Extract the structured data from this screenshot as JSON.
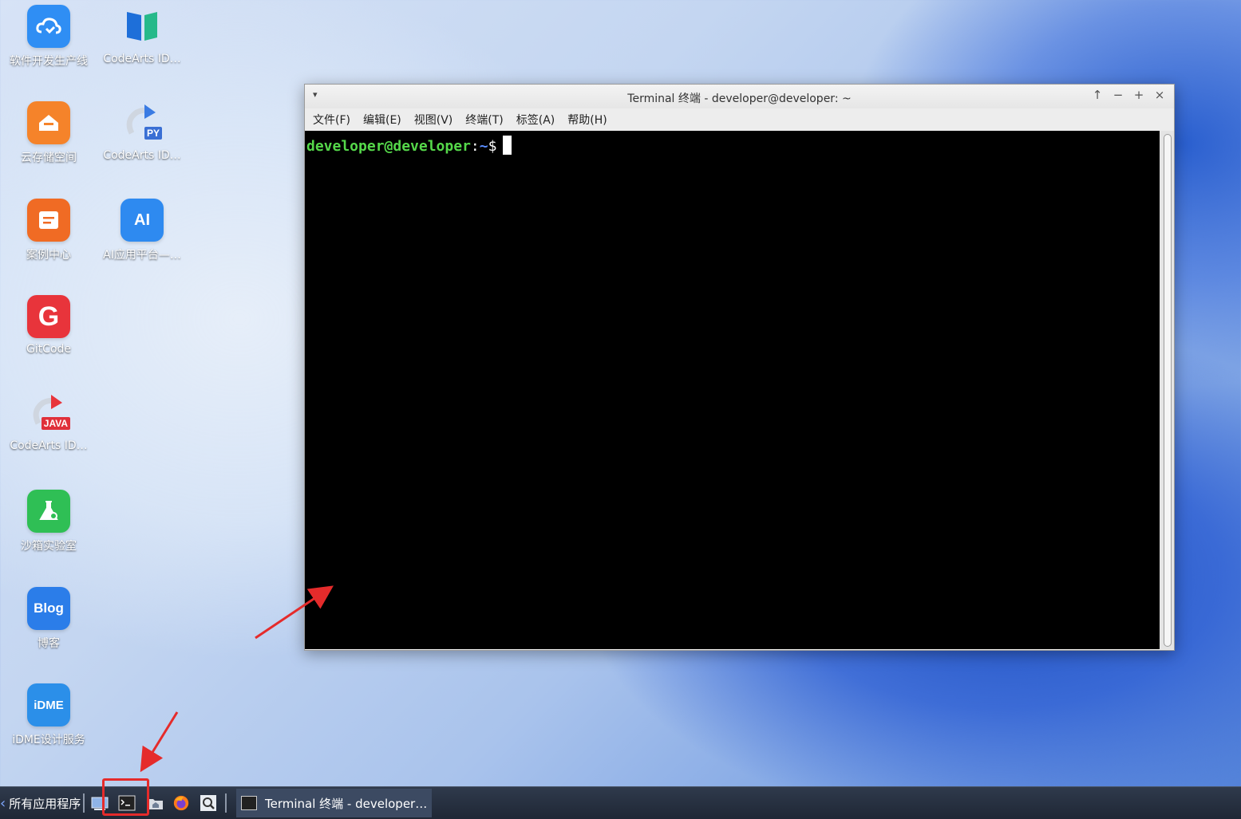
{
  "desktop": {
    "icons": [
      {
        "label": "软件开发生产线",
        "icon": "cloud-devops-icon",
        "color": "#2f8ef4"
      },
      {
        "label": "CodeArts ID…",
        "icon": "codearts-ide-icon",
        "color": "#1e6fd9"
      },
      {
        "label": "云存储空间",
        "icon": "cloud-storage-icon",
        "color": "#f5832a"
      },
      {
        "label": "CodeArts ID…",
        "icon": "codearts-python-icon",
        "color": "#3a7be3",
        "badge": "PY"
      },
      {
        "label": "案例中心",
        "icon": "case-center-icon",
        "color": "#f06b24"
      },
      {
        "label": "AI应用平台—…",
        "icon": "ai-platform-icon",
        "color": "#2e8af0",
        "badge": "AI"
      },
      {
        "label": "GitCode",
        "icon": "gitcode-icon",
        "color": "#e8343b",
        "badge": "G"
      },
      {
        "label": "CodeArts ID…",
        "icon": "codearts-java-icon",
        "color": "#d93a3a",
        "badge": "JAVA"
      },
      {
        "label": "沙箱实验室",
        "icon": "sandbox-lab-icon",
        "color": "#2fbf55"
      },
      {
        "label": "博客",
        "icon": "blog-icon",
        "color": "#2b7de9",
        "badge": "Blog"
      },
      {
        "label": "iDME设计服务",
        "icon": "idme-icon",
        "color": "#2b8fe9",
        "badge": "iDME"
      }
    ]
  },
  "terminal": {
    "title": "Terminal 终端 - developer@developer: ~",
    "menu": [
      "文件(F)",
      "编辑(E)",
      "视图(V)",
      "终端(T)",
      "标签(A)",
      "帮助(H)"
    ],
    "prompt": {
      "user": "developer@developer",
      "colon": ":",
      "path": "~",
      "dollar": "$"
    },
    "controls": {
      "up": "↑",
      "minimize": "−",
      "maximize": "+",
      "close": "×"
    },
    "menu_arrow": "▾"
  },
  "taskbar": {
    "start_label": "所有应用程序",
    "task_label": "Terminal 终端 - developer…"
  },
  "annotations": {
    "arrow_color": "#e52b2b",
    "highlight_color": "#e52b2b"
  }
}
